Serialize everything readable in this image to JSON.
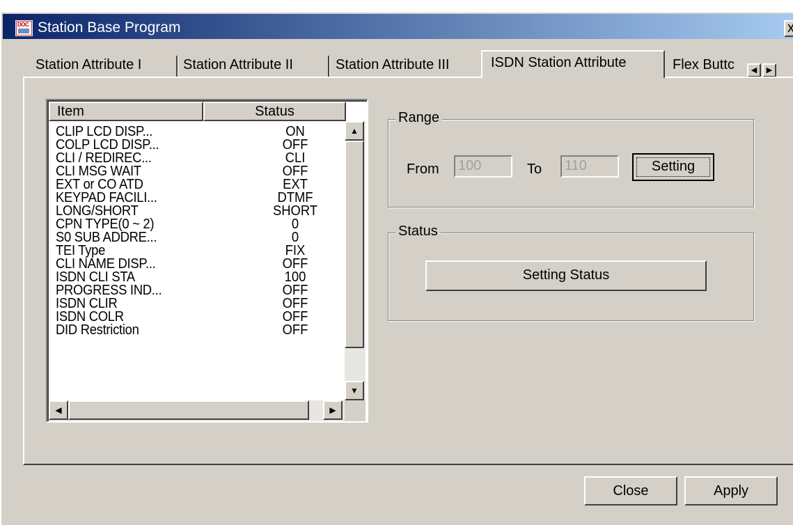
{
  "window": {
    "title": "Station Base Program",
    "icon_text": "DOC",
    "close_glyph": "x"
  },
  "tabs": [
    {
      "label": "Station Attribute I"
    },
    {
      "label": "Station Attribute II"
    },
    {
      "label": "Station Attribute III"
    },
    {
      "label": "ISDN Station Attribute"
    },
    {
      "label": "Flex Buttc"
    }
  ],
  "active_tab": "ISDN Station Attribute",
  "list": {
    "columns": [
      "Item",
      "Status"
    ],
    "rows": [
      {
        "item": "CLIP LCD DISP...",
        "status": "ON"
      },
      {
        "item": "COLP LCD DISP...",
        "status": "OFF"
      },
      {
        "item": "CLI / REDIREC...",
        "status": "CLI"
      },
      {
        "item": "CLI MSG WAIT",
        "status": "OFF"
      },
      {
        "item": "EXT or CO ATD",
        "status": "EXT"
      },
      {
        "item": "KEYPAD FACILI...",
        "status": "DTMF"
      },
      {
        "item": "LONG/SHORT",
        "status": "SHORT"
      },
      {
        "item": "CPN TYPE(0 ~ 2)",
        "status": "0"
      },
      {
        "item": "S0 SUB ADDRE...",
        "status": "0"
      },
      {
        "item": "TEI Type",
        "status": "FIX"
      },
      {
        "item": "CLI NAME DISP...",
        "status": "OFF"
      },
      {
        "item": "ISDN CLI STA",
        "status": "100"
      },
      {
        "item": "PROGRESS IND...",
        "status": "OFF"
      },
      {
        "item": "ISDN CLIR",
        "status": "OFF"
      },
      {
        "item": "ISDN COLR",
        "status": "OFF"
      },
      {
        "item": "DID Restriction",
        "status": "OFF"
      }
    ]
  },
  "range": {
    "label": "Range",
    "from_label": "From",
    "from_value": "100",
    "to_label": "To",
    "to_value": "110",
    "setting_button": "Setting"
  },
  "status_group": {
    "label": "Status",
    "button": "Setting Status"
  },
  "footer": {
    "close_button": "Close",
    "apply_button": "Apply"
  }
}
